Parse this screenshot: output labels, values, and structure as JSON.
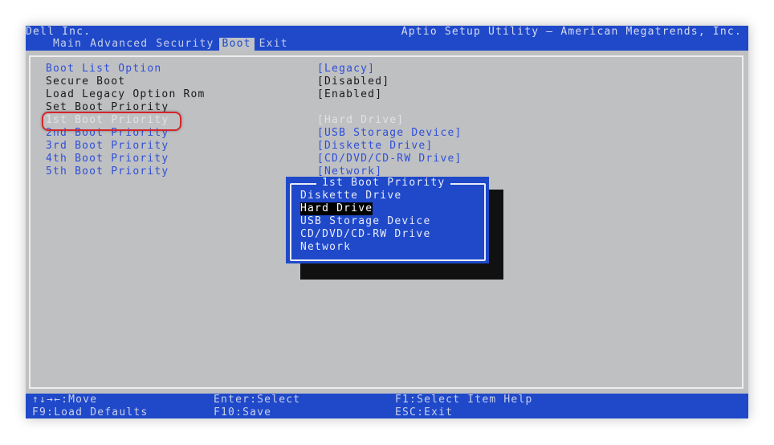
{
  "header": {
    "vendor": "Dell Inc.",
    "utility_title": "Aptio Setup Utility – American Megatrends, Inc.",
    "tabs": [
      "Main",
      "Advanced",
      "Security",
      "Boot",
      "Exit"
    ],
    "active_tab": "Boot"
  },
  "settings": [
    {
      "label": "Boot List Option",
      "value": "[Legacy]"
    },
    {
      "label": "Secure Boot",
      "value": "[Disabled]"
    },
    {
      "label": "Load Legacy Option Rom",
      "value": "[Enabled]"
    },
    {
      "label": "Set Boot Priority",
      "value": ""
    },
    {
      "label": "1st Boot Priority",
      "value": "[Hard Drive]"
    },
    {
      "label": "2nd Boot Priority",
      "value": "[USB Storage Device]"
    },
    {
      "label": "3rd Boot Priority",
      "value": "[Diskette Drive]"
    },
    {
      "label": "4th Boot Priority",
      "value": "[CD/DVD/CD-RW Drive]"
    },
    {
      "label": "5th Boot Priority",
      "value": "[Network]"
    }
  ],
  "popup": {
    "title": "1st Boot Priority",
    "options": [
      "Diskette Drive",
      "Hard Drive",
      "USB Storage Device",
      "CD/DVD/CD-RW Drive",
      "Network"
    ],
    "selected": "Hard Drive"
  },
  "footer": {
    "move": "↑↓→←:Move",
    "select": "Enter:Select",
    "help": "F1:Select Item Help",
    "defaults": "F9:Load Defaults",
    "save": "F10:Save",
    "exit": "ESC:Exit"
  },
  "colors": {
    "bar_blue": "#1f49c9",
    "screen_gray": "#bfc0c2",
    "link_blue": "#2f4fd8",
    "highlight_red": "#d4262a"
  }
}
